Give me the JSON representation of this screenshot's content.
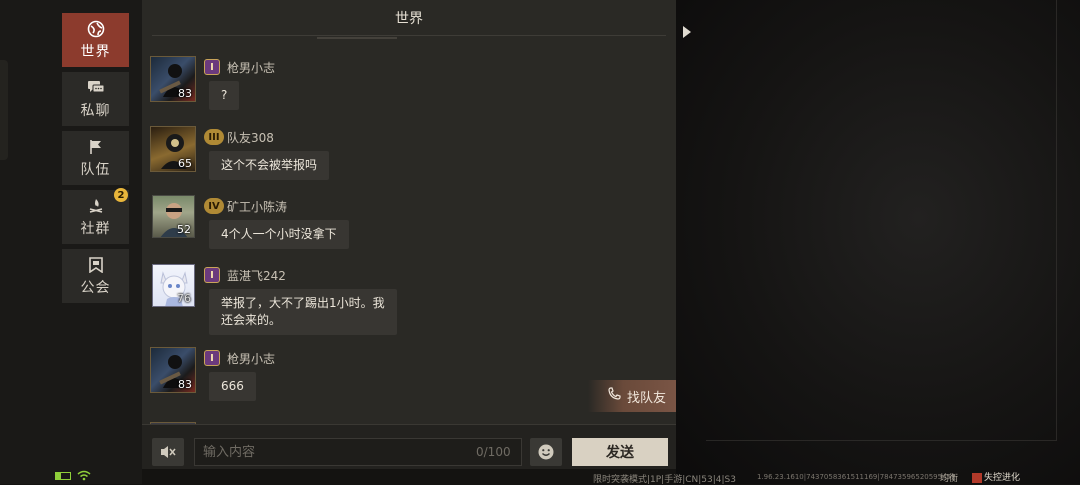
{
  "nav": [
    {
      "label": "世界",
      "icon": "globe-icon",
      "active": true
    },
    {
      "label": "私聊",
      "icon": "chat-bubble-icon"
    },
    {
      "label": "队伍",
      "icon": "flag-icon"
    },
    {
      "label": "社群",
      "icon": "campfire-icon",
      "badge": "2"
    },
    {
      "label": "公会",
      "icon": "banner-icon"
    }
  ],
  "channel": {
    "title": "世界"
  },
  "messages": [
    {
      "name": "枪男小志",
      "rank": "I",
      "level": "83",
      "text": "?"
    },
    {
      "name": "队友308",
      "rank": "III",
      "level": "65",
      "text": "这个不会被举报吗"
    },
    {
      "name": "矿工小陈涛",
      "rank": "IV",
      "level": "52",
      "text": "4个人一个小时没拿下"
    },
    {
      "name": "蓝湛飞242",
      "rank": "I",
      "level": "76",
      "text_lines": [
        "举报了，大不了踢出1小时。我",
        "还会来的。"
      ]
    },
    {
      "name": "枪男小志",
      "rank": "I",
      "level": "83",
      "text": "666"
    }
  ],
  "find_team": {
    "label": "找队友"
  },
  "input": {
    "placeholder": "输入内容",
    "value": "",
    "counter": "0/100"
  },
  "send": {
    "label": "发送"
  },
  "footer": {
    "mode": "限时突袭模式|1P|手游|CN|53|4|S3",
    "version": "1.96.23.1610|7437058361511169|7847359652059545​7",
    "tag1": "均衡",
    "tag2": "失控进化"
  },
  "colors": {
    "accent": "#8c3b2d",
    "badge": "#e8b63b",
    "send_bg": "#d9d1c2"
  }
}
